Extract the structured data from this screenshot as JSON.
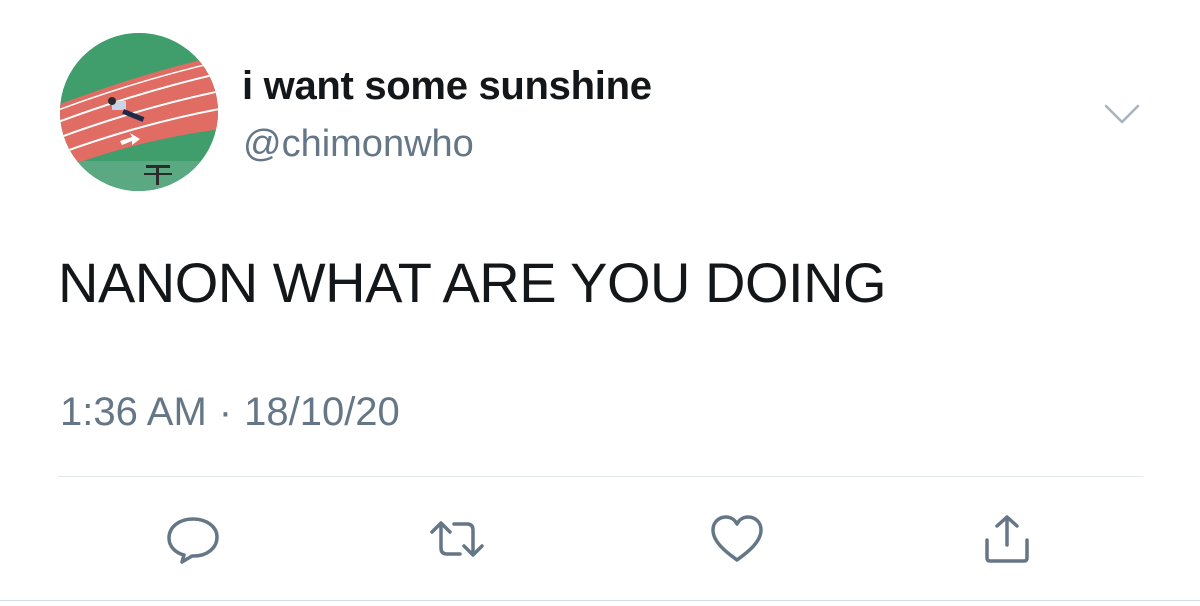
{
  "author": {
    "display_name": "i want some sunshine",
    "handle": "@chimonwho",
    "avatar_icon": "profile-photo"
  },
  "tweet": {
    "text": "NANON WHAT ARE YOU DOING",
    "time": "1:36 AM",
    "separator": "·",
    "date": "18/10/20"
  },
  "actions": {
    "reply_icon": "reply-icon",
    "retweet_icon": "retweet-icon",
    "like_icon": "heart-icon",
    "share_icon": "share-icon",
    "menu_icon": "chevron-down-icon"
  },
  "colors": {
    "icon_gray": "#657786",
    "text": "#14171a",
    "divider": "#e1e8ed",
    "track_red": "#e06c64",
    "field_green": "#3f9e6b"
  }
}
